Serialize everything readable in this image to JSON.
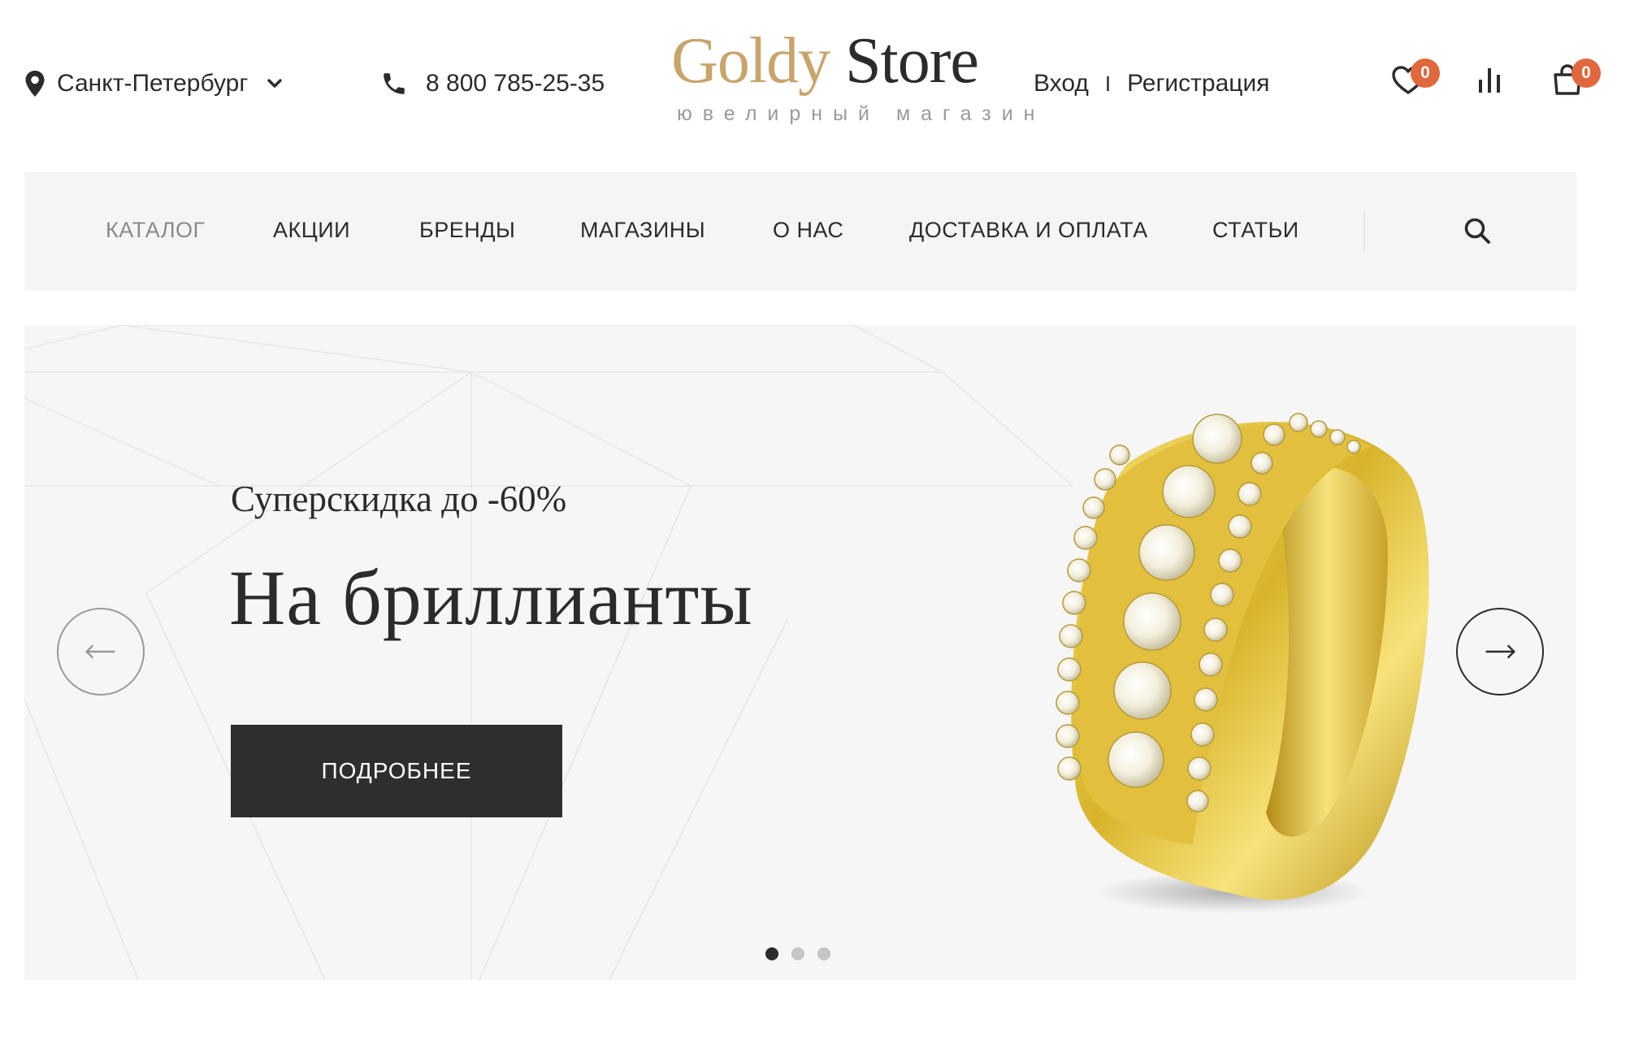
{
  "header": {
    "city": "Санкт-Петербург",
    "phone": "8 800 785-25-35",
    "logo": {
      "word1": "Goldy",
      "word2": "Store",
      "tagline": "ювелирный магазин"
    },
    "auth": {
      "login": "Вход",
      "separator": "I",
      "register": "Регистрация"
    },
    "favorites_count": "0",
    "cart_count": "0",
    "colors": {
      "accent_gold": "#c9a46a",
      "badge": "#e0683c",
      "text": "#2b2b2b"
    }
  },
  "nav": {
    "items": [
      {
        "label": "КАТАЛОГ"
      },
      {
        "label": "АКЦИИ"
      },
      {
        "label": "БРЕНДЫ"
      },
      {
        "label": "МАГАЗИНЫ"
      },
      {
        "label": "О НАС"
      },
      {
        "label": "ДОСТАВКА И ОПЛАТА"
      },
      {
        "label": "СТАТЬИ"
      }
    ],
    "search_icon": "search-icon"
  },
  "hero": {
    "eyebrow": "Суперскидка до -60%",
    "title": "На бриллианты",
    "cta": "ПОДРОБНЕЕ",
    "slides_total": 3,
    "active_slide": 1
  }
}
